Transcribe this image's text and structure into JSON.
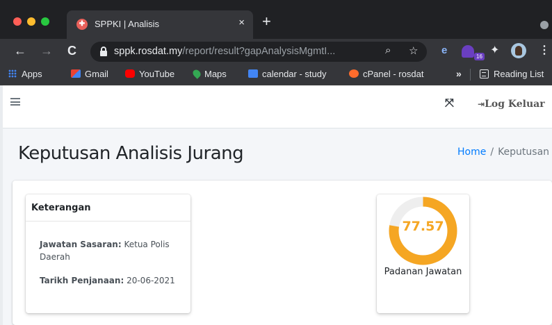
{
  "browser": {
    "tab_title": "SPPKI | Analisis",
    "tab_close": "×",
    "new_tab": "+",
    "url_host": "sppk.rosdat.my",
    "url_path": "/report/result?gapAnalysisMgmtI...",
    "extension_badge": "16",
    "bookmarks": {
      "apps": "Apps",
      "gmail": "Gmail",
      "youtube": "YouTube",
      "maps": "Maps",
      "calendar": "calendar - study",
      "cpanel": "cPanel - rosdat",
      "more": "»",
      "reading_list": "Reading List"
    },
    "icons": {
      "back": "←",
      "forward": "→",
      "reload": "C",
      "zoom": "⌕",
      "star": "☆",
      "puzzle": "✦",
      "menu": "⋮"
    }
  },
  "topnav": {
    "logout_icon": "⇥",
    "logout_label": "Log Keluar",
    "fullscreen_icon": "⤧"
  },
  "header": {
    "title": "Keputusan Analisis Jurang",
    "breadcrumb": {
      "home": "Home",
      "separator": "/",
      "active": "Keputusan"
    }
  },
  "info_card": {
    "title": "Keterangan",
    "rows": [
      {
        "label": "Jawatan Sasaran:",
        "value": "Ketua Polis Daerah"
      },
      {
        "label": "Tarikh Penjanaan:",
        "value": "20-06-2021"
      }
    ]
  },
  "gauge": {
    "value_text": "77.57",
    "percent": 77.57,
    "label": "Padanan Jawatan",
    "color": "#f5a623",
    "track_color": "#eeeeee"
  }
}
